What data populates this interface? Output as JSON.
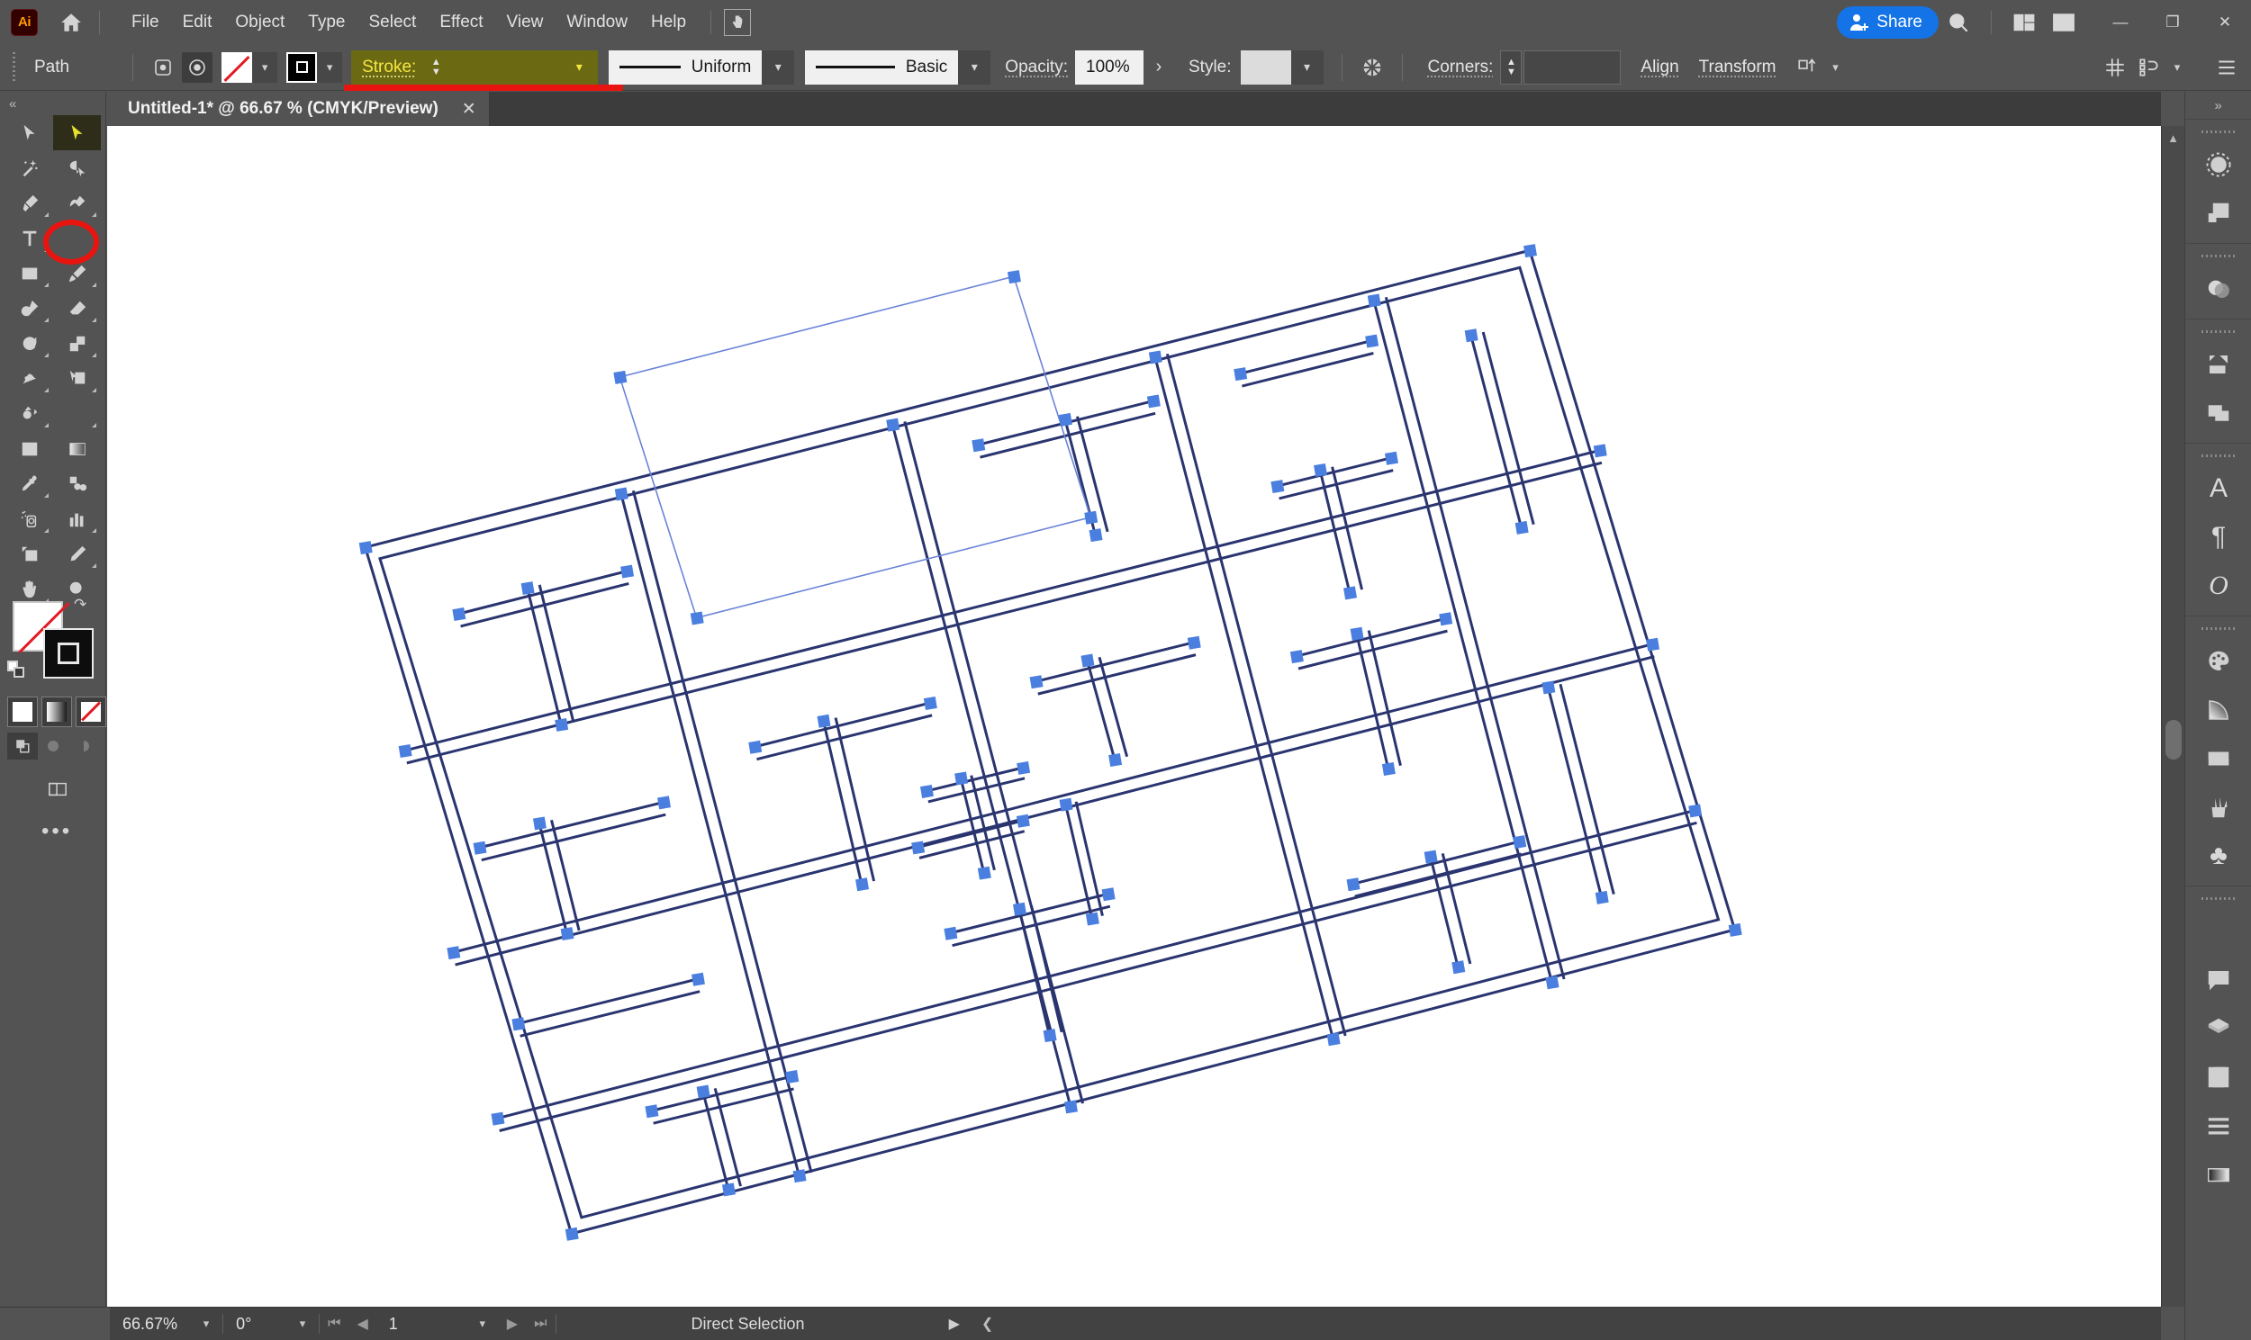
{
  "app": {
    "logo_text": "Ai",
    "home_icon": "home-icon",
    "hand_tool_icon": "touch-hand-icon"
  },
  "menubar": {
    "items": [
      {
        "label": "File"
      },
      {
        "label": "Edit"
      },
      {
        "label": "Object"
      },
      {
        "label": "Type"
      },
      {
        "label": "Select"
      },
      {
        "label": "Effect"
      },
      {
        "label": "View"
      },
      {
        "label": "Window"
      },
      {
        "label": "Help"
      }
    ],
    "share_label": "Share",
    "search_icon": "search-icon",
    "arrange_icon": "arrange-documents-icon",
    "workspace_icon": "workspace-switcher-icon",
    "window_controls": {
      "minimize": "—",
      "maximize": "❐",
      "close": "✕"
    }
  },
  "controlbar": {
    "object_type": "Path",
    "anchor_icon": "anchor-points-icon",
    "isolate_icon": "isolate-selection-icon",
    "fill_label": "fill-swatch-none",
    "stroke_swatch_label": "stroke-swatch-black",
    "stroke_label": "Stroke:",
    "stroke_weight_value": "",
    "profile_label": "Uniform",
    "brush_label": "Basic",
    "opacity_label": "Opacity:",
    "opacity_value": "100%",
    "style_label": "Style:",
    "corners_label": "Corners:",
    "corners_value": "",
    "align_label": "Align",
    "transform_label": "Transform",
    "highlight_color": "#6b6a13",
    "highlight_text_color": "#f5e642",
    "annotation_color": "#e8140f"
  },
  "document_tab": {
    "title": "Untitled-1* @ 66.67 % (CMYK/Preview)",
    "close_icon": "close-icon"
  },
  "toolbar": {
    "collapse_icon": "«",
    "tools": [
      {
        "name": "selection-tool",
        "icon": "arrow-solid-icon",
        "selected": false,
        "has_flyout": false
      },
      {
        "name": "direct-selection-tool",
        "icon": "arrow-hollow-icon",
        "selected": true,
        "has_flyout": false
      },
      {
        "name": "magic-wand-tool",
        "icon": "magic-wand-icon",
        "selected": false,
        "has_flyout": false
      },
      {
        "name": "lasso-tool",
        "icon": "lasso-icon",
        "selected": false,
        "has_flyout": false
      },
      {
        "name": "pen-tool",
        "icon": "pen-icon",
        "selected": false,
        "has_flyout": true
      },
      {
        "name": "curvature-tool",
        "icon": "curvature-icon",
        "selected": false,
        "has_flyout": true
      },
      {
        "name": "type-tool",
        "icon": "type-t-icon",
        "selected": false,
        "has_flyout": true
      },
      {
        "name": "line-segment-tool",
        "icon": "line-icon",
        "selected": false,
        "has_flyout": true
      },
      {
        "name": "rectangle-tool",
        "icon": "rectangle-icon",
        "selected": false,
        "has_flyout": true
      },
      {
        "name": "paintbrush-tool",
        "icon": "paintbrush-icon",
        "selected": false,
        "has_flyout": true
      },
      {
        "name": "shaper-tool",
        "icon": "shaper-pencil-icon",
        "selected": false,
        "has_flyout": true
      },
      {
        "name": "eraser-tool",
        "icon": "eraser-icon",
        "selected": false,
        "has_flyout": true
      },
      {
        "name": "rotate-tool",
        "icon": "rotate-icon",
        "selected": false,
        "has_flyout": true
      },
      {
        "name": "scale-tool",
        "icon": "scale-icon",
        "selected": false,
        "has_flyout": true
      },
      {
        "name": "width-tool",
        "icon": "width-warp-icon",
        "selected": false,
        "has_flyout": true
      },
      {
        "name": "free-transform-tool",
        "icon": "free-transform-icon",
        "selected": false,
        "has_flyout": true
      },
      {
        "name": "shape-builder-tool",
        "icon": "shape-builder-icon",
        "selected": false,
        "has_flyout": true
      },
      {
        "name": "perspective-grid-tool",
        "icon": "perspective-grid-icon",
        "selected": false,
        "has_flyout": true
      },
      {
        "name": "mesh-tool",
        "icon": "mesh-icon",
        "selected": false,
        "has_flyout": false
      },
      {
        "name": "gradient-tool",
        "icon": "gradient-icon",
        "selected": false,
        "has_flyout": false
      },
      {
        "name": "eyedropper-tool",
        "icon": "eyedropper-icon",
        "selected": false,
        "has_flyout": true
      },
      {
        "name": "blend-tool",
        "icon": "blend-icon",
        "selected": false,
        "has_flyout": false
      },
      {
        "name": "symbol-sprayer-tool",
        "icon": "symbol-sprayer-icon",
        "selected": false,
        "has_flyout": true
      },
      {
        "name": "column-graph-tool",
        "icon": "bar-graph-icon",
        "selected": false,
        "has_flyout": true
      },
      {
        "name": "artboard-tool",
        "icon": "artboard-icon",
        "selected": false,
        "has_flyout": false
      },
      {
        "name": "slice-tool",
        "icon": "slice-knife-icon",
        "selected": false,
        "has_flyout": true
      },
      {
        "name": "hand-tool",
        "icon": "hand-icon",
        "selected": false,
        "has_flyout": true
      },
      {
        "name": "zoom-tool",
        "icon": "magnifier-icon",
        "selected": false,
        "has_flyout": false
      }
    ],
    "fill_swatch": "fill-none-swatch",
    "stroke_swatch": "stroke-black-swatch",
    "swap_icon": "swap-fill-stroke-icon",
    "default_icon": "default-fill-stroke-icon",
    "color_modes": [
      {
        "name": "color-mode-button",
        "icon": "solid-color-icon"
      },
      {
        "name": "gradient-mode-button",
        "icon": "gradient-icon"
      },
      {
        "name": "none-mode-button",
        "icon": "none-icon"
      }
    ],
    "draw_modes": [
      {
        "name": "draw-normal-button",
        "icon": "draw-normal-icon",
        "active": true
      },
      {
        "name": "draw-behind-button",
        "icon": "draw-behind-icon",
        "active": false
      },
      {
        "name": "draw-inside-button",
        "icon": "draw-inside-icon",
        "active": false
      }
    ],
    "screen_mode": "change-screen-mode-icon",
    "more_tools": "•••"
  },
  "statusbar": {
    "zoom_value": "66.67%",
    "rotation_value": "0°",
    "page_value": "1",
    "status_text": "Direct Selection",
    "first_icon": "first-artboard-icon",
    "prev_icon": "prev-artboard-icon",
    "next_icon": "next-artboard-icon",
    "last_icon": "last-artboard-icon",
    "play_icon": "play-icon",
    "collapse_icon": "collapse-status-icon"
  },
  "right_dock": {
    "collapse_icon": "»",
    "groups": [
      {
        "icons": [
          {
            "name": "properties-panel-icon",
            "glyph": "circle-dashed"
          },
          {
            "name": "layers-panel-icon",
            "glyph": "layers-squares"
          }
        ]
      },
      {
        "icons": [
          {
            "name": "transparency-panel-icon",
            "glyph": "two-circles"
          }
        ]
      },
      {
        "icons": [
          {
            "name": "asset-export-panel-icon",
            "glyph": "export-arrow"
          },
          {
            "name": "artboards-panel-icon",
            "glyph": "two-rects"
          }
        ]
      },
      {
        "icons": [
          {
            "name": "character-panel-icon",
            "glyph": "A"
          },
          {
            "name": "paragraph-panel-icon",
            "glyph": "¶"
          },
          {
            "name": "opentype-panel-icon",
            "glyph": "O"
          }
        ]
      },
      {
        "icons": [
          {
            "name": "color-panel-icon",
            "glyph": "palette"
          },
          {
            "name": "color-guide-panel-icon",
            "glyph": "color-wheel"
          },
          {
            "name": "swatches-panel-icon",
            "glyph": "swatch-grid"
          },
          {
            "name": "brushes-panel-icon",
            "glyph": "brush-pot"
          },
          {
            "name": "symbols-panel-icon",
            "glyph": "♣"
          }
        ]
      },
      {
        "icons": [
          {
            "name": "appearance-panel-icon",
            "glyph": "sliders"
          },
          {
            "name": "comments-panel-icon",
            "glyph": "speech-bubble"
          },
          {
            "name": "layers2-panel-icon",
            "glyph": "stacked-diamond"
          },
          {
            "name": "libraries-panel-icon",
            "glyph": "book"
          },
          {
            "name": "align-panel-icon",
            "glyph": "lines"
          },
          {
            "name": "gradient-panel-icon",
            "glyph": "gradient-rect"
          }
        ]
      }
    ]
  },
  "canvas": {
    "artwork_name": "architectural-floor-plan",
    "wall_color": "#2a3570",
    "anchor_color": "#4a7fe0",
    "selection_path_color": "#6a84d8",
    "rotation_deg": -9.5,
    "description": "Rotated architectural floor plan composed of double-line walls with visible blue anchor points from Direct Selection"
  }
}
